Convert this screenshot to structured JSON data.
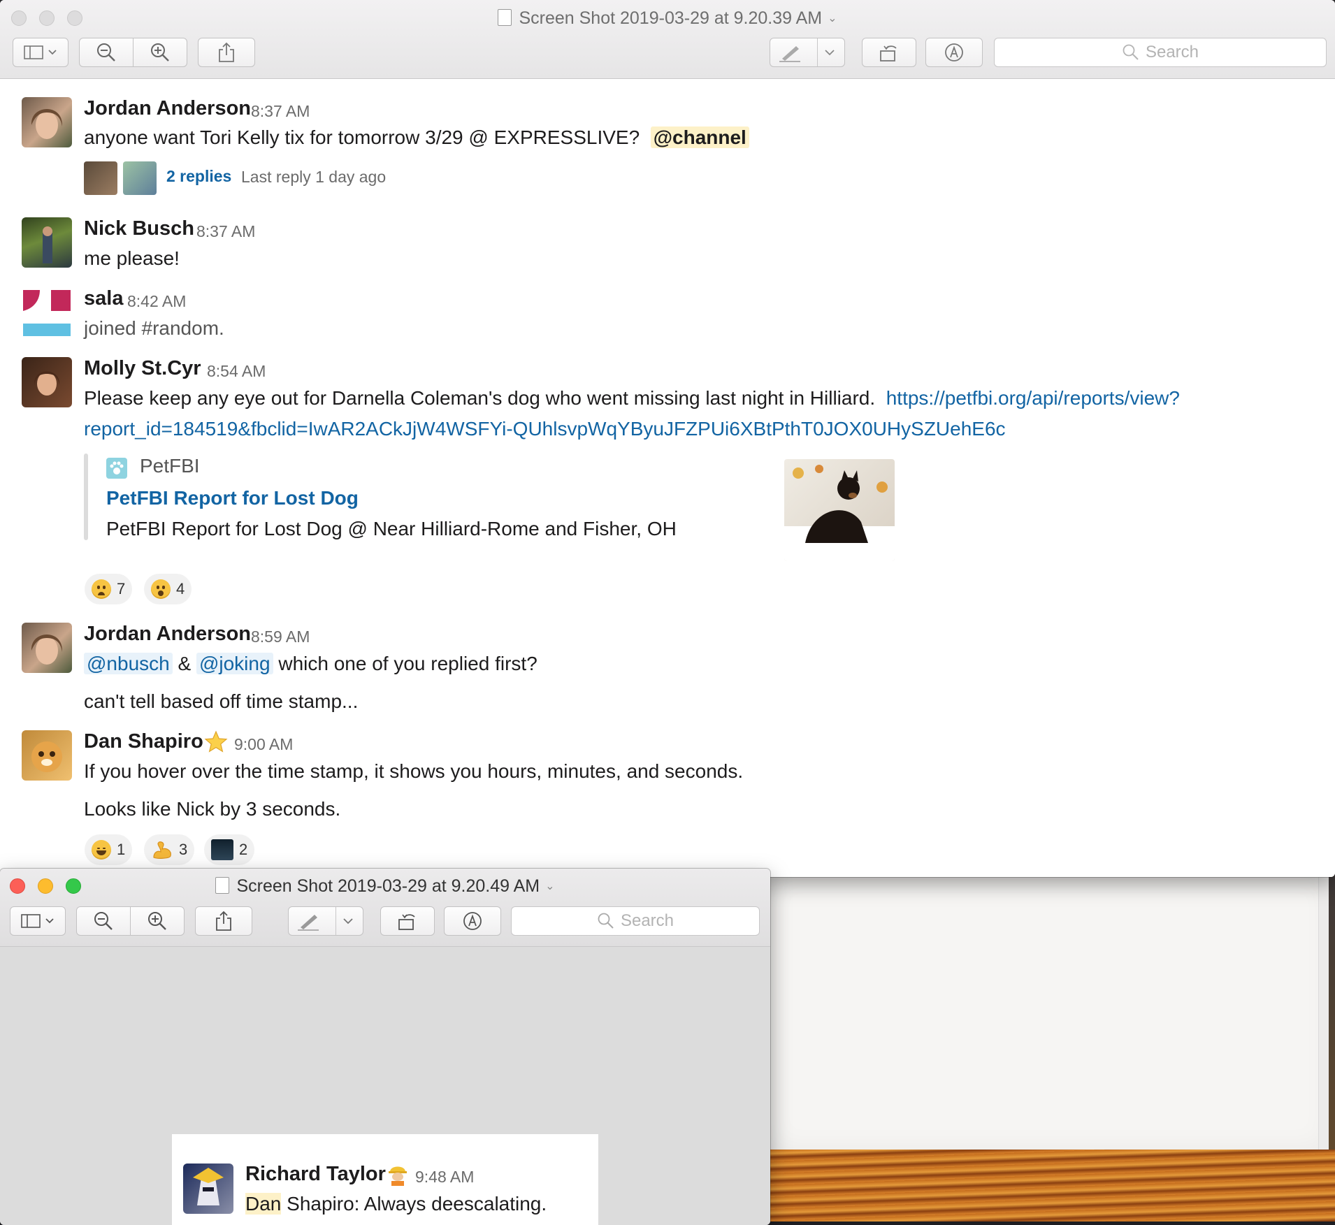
{
  "windows": {
    "main": {
      "title": "Screen Shot 2019-03-29 at 9.20.39 AM",
      "search_placeholder": "Search"
    },
    "second": {
      "title": "Screen Shot 2019-03-29 at 9.20.49 AM",
      "search_placeholder": "Search"
    }
  },
  "messages": {
    "m1": {
      "name": "Jordan Anderson",
      "time": "8:37 AM",
      "text": "anyone want Tori Kelly tix for tomorrow 3/29 @ EXPRESSLIVE?",
      "mention": "@channel",
      "replies_label": "2 replies",
      "last_reply": "Last reply 1 day ago"
    },
    "m2": {
      "name": "Nick Busch",
      "time": "8:37 AM",
      "text": "me please!"
    },
    "m3": {
      "name": "sala",
      "time": "8:42 AM",
      "text": "joined #random."
    },
    "m4": {
      "name": "Molly St.Cyr",
      "time": "8:54 AM",
      "text": "Please keep any eye out for Darnella Coleman's dog who went missing last night in Hilliard.",
      "link_part1": "https://petfbi.org/api/reports/view?",
      "link_part2": "report_id=184519&fbclid=IwAR2ACkJjW4WSFYi-QUhlsvpWqYByuJFZPUi6XBtPthT0JOX0UHySZUehE6c",
      "unfurl": {
        "site": "PetFBI",
        "title": "PetFBI Report for Lost Dog",
        "description": "PetFBI Report for Lost Dog @ Near Hilliard-Rome and Fisher, OH"
      },
      "reactions": [
        {
          "emoji": "worried-face",
          "count": "7"
        },
        {
          "emoji": "hushed-face",
          "count": "4"
        }
      ]
    },
    "m5": {
      "name": "Jordan Anderson",
      "time": "8:59 AM",
      "mention1": "@nbusch",
      "amp": "&",
      "mention2": "@joking",
      "text_after": "which one of you replied first?",
      "text2": "can't tell based off time stamp..."
    },
    "m6": {
      "name": "Dan Shapiro",
      "time": "9:00 AM",
      "status_emoji": "star",
      "text": "If you hover over the time stamp, it shows you hours, minutes, and seconds.",
      "text2": "Looks like Nick by 3 seconds.",
      "reactions": [
        {
          "emoji": "laughing-face",
          "count": "1"
        },
        {
          "emoji": "flexed-biceps",
          "count": "3"
        },
        {
          "emoji": "custom-image",
          "count": "2"
        }
      ]
    },
    "m7": {
      "name": "Richard Taylor",
      "time": "9:48 AM",
      "status_emoji": "construction-worker",
      "highlight": "Dan",
      "text": "Shapiro: Always deescalating."
    }
  },
  "colors": {
    "link": "#1264a3",
    "mention_bg": "#fdf1c8",
    "user_mention_bg": "#e8f2fa",
    "traffic_red": "#fc5f57",
    "traffic_yellow": "#fdbc2e",
    "traffic_green": "#34c84a"
  }
}
